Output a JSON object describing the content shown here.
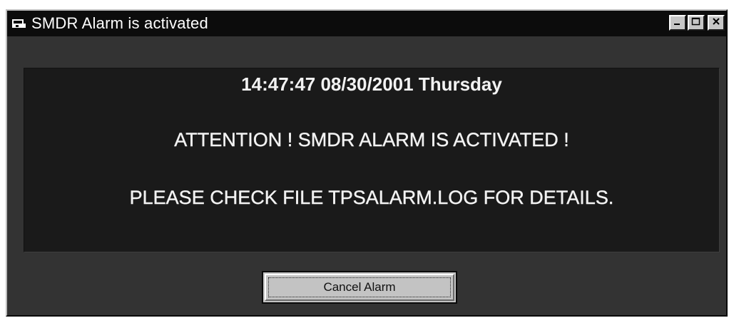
{
  "window": {
    "title": "SMDR Alarm is activated",
    "icons": {
      "app": "app-window-icon",
      "minimize": "minimize-icon",
      "maximize": "maximize-icon",
      "close": "close-icon"
    }
  },
  "message": {
    "timestamp": "14:47:47 08/30/2001 Thursday",
    "attention": "ATTENTION ! SMDR ALARM IS ACTIVATED !",
    "instruction": "PLEASE CHECK FILE TPSALARM.LOG FOR DETAILS."
  },
  "buttons": {
    "cancel_label": "Cancel Alarm"
  },
  "colors": {
    "titlebar": "#0c0c0c",
    "window_bg": "#333333",
    "panel_bg": "#1a1a1a",
    "text": "#f2f2f2",
    "button_face": "#c3c3c3"
  }
}
